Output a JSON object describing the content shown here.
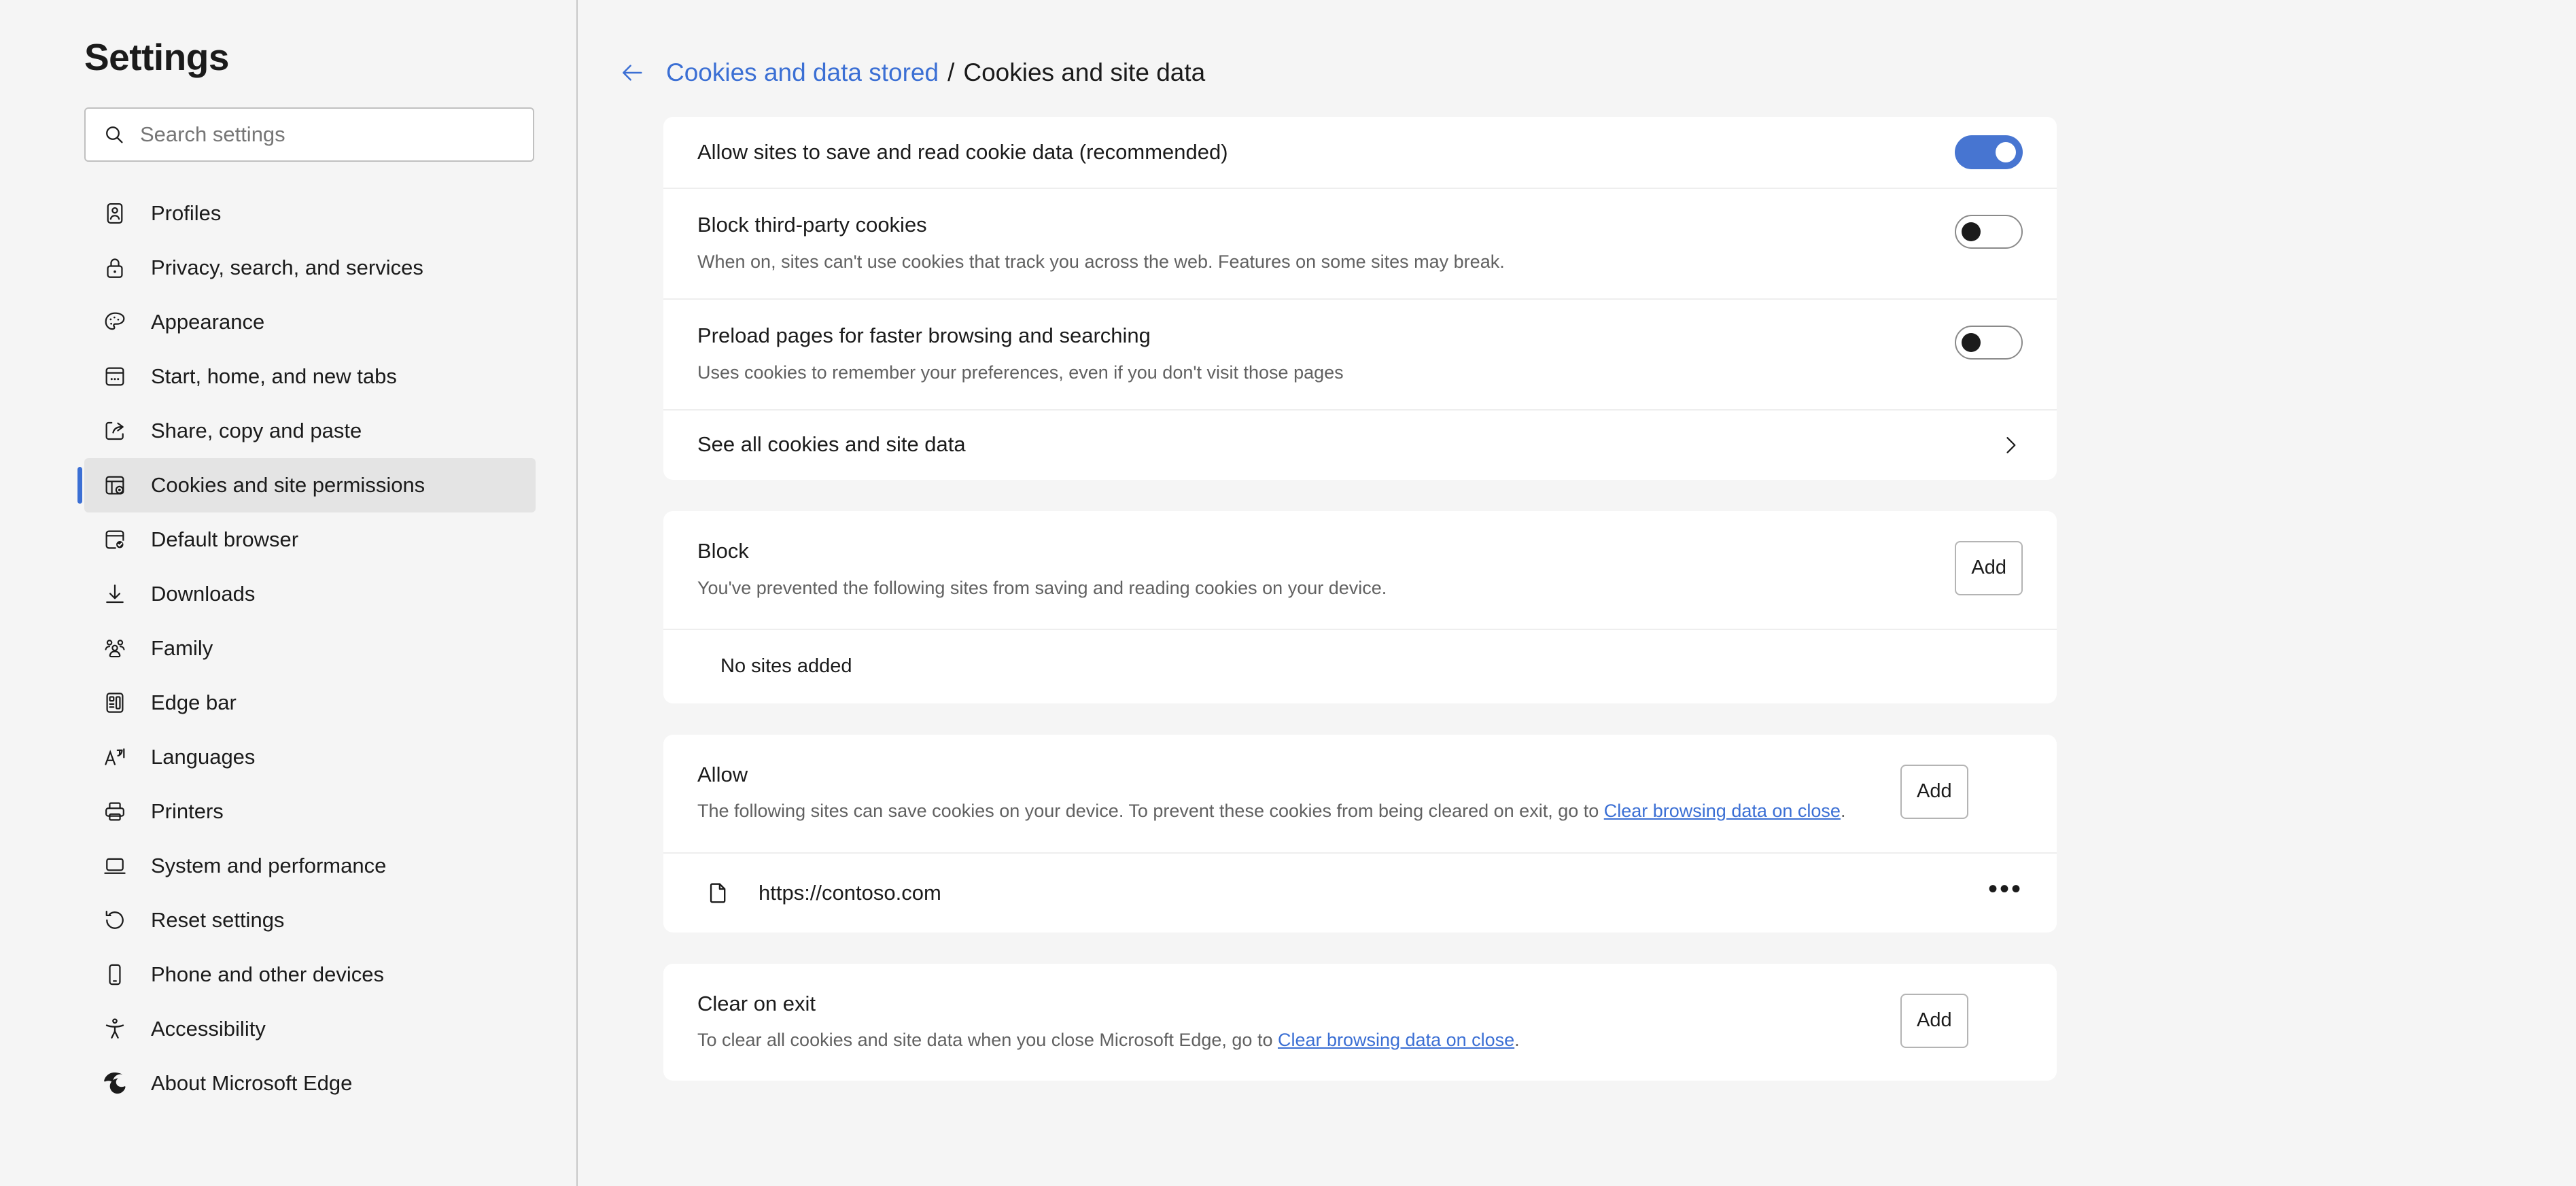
{
  "sidebar": {
    "title": "Settings",
    "search": {
      "placeholder": "Search settings",
      "value": "",
      "icon": "search-icon"
    },
    "items": [
      {
        "label": "Profiles",
        "icon": "profiles-icon",
        "selected": false
      },
      {
        "label": "Privacy, search, and services",
        "icon": "lock-icon",
        "selected": false
      },
      {
        "label": "Appearance",
        "icon": "palette-icon",
        "selected": false
      },
      {
        "label": "Start, home, and new tabs",
        "icon": "window-new-tab-icon",
        "selected": false
      },
      {
        "label": "Share, copy and paste",
        "icon": "share-icon",
        "selected": false
      },
      {
        "label": "Cookies and site permissions",
        "icon": "cookies-permissions-icon",
        "selected": true
      },
      {
        "label": "Default browser",
        "icon": "default-browser-icon",
        "selected": false
      },
      {
        "label": "Downloads",
        "icon": "download-icon",
        "selected": false
      },
      {
        "label": "Family",
        "icon": "family-icon",
        "selected": false
      },
      {
        "label": "Edge bar",
        "icon": "edge-bar-icon",
        "selected": false
      },
      {
        "label": "Languages",
        "icon": "languages-icon",
        "selected": false
      },
      {
        "label": "Printers",
        "icon": "printer-icon",
        "selected": false
      },
      {
        "label": "System and performance",
        "icon": "laptop-icon",
        "selected": false
      },
      {
        "label": "Reset settings",
        "icon": "reset-icon",
        "selected": false
      },
      {
        "label": "Phone and other devices",
        "icon": "phone-icon",
        "selected": false
      },
      {
        "label": "Accessibility",
        "icon": "accessibility-icon",
        "selected": false
      },
      {
        "label": "About Microsoft Edge",
        "icon": "edge-logo-icon",
        "selected": false
      }
    ]
  },
  "breadcrumb": {
    "back_icon": "back-arrow-icon",
    "parent": "Cookies and data stored",
    "separator": "/",
    "current": "Cookies and site data"
  },
  "cookie_settings": {
    "allow_save_read": {
      "title": "Allow sites to save and read cookie data (recommended)",
      "toggle_state": "on"
    },
    "block_third_party": {
      "title": "Block third-party cookies",
      "description": "When on, sites can't use cookies that track you across the web. Features on some sites may break.",
      "toggle_state": "off"
    },
    "preload_pages": {
      "title": "Preload pages for faster browsing and searching",
      "description": "Uses cookies to remember your preferences, even if you don't visit those pages",
      "toggle_state": "off"
    },
    "see_all": {
      "title": "See all cookies and site data",
      "icon": "chevron-right-icon"
    }
  },
  "block_section": {
    "title": "Block",
    "description": "You've prevented the following sites from saving and reading cookies on your device.",
    "add_label": "Add",
    "empty_text": "No sites added"
  },
  "allow_section": {
    "title": "Allow",
    "description_before": "The following sites can save cookies on your device. To prevent these cookies from being cleared on exit, go to ",
    "link_text": "Clear browsing data on close",
    "description_after": ".",
    "add_label": "Add",
    "sites": [
      {
        "name": "https://contoso.com",
        "icon": "document-icon",
        "more_icon": "more-options-icon",
        "more_label": "•••"
      }
    ]
  },
  "clear_on_exit_section": {
    "title": "Clear on exit",
    "description_before": "To clear all cookies and site data when you close Microsoft Edge, go to ",
    "link_text": "Clear browsing data on close",
    "description_after": ".",
    "add_label": "Add"
  },
  "colors": {
    "accent": "#3b6fd4",
    "toggle_on": "#4775d1",
    "page_bg": "#f5f5f5",
    "card_bg": "#ffffff",
    "selected_bg": "#e4e4e4",
    "text_primary": "#1b1b1b",
    "text_secondary": "#616161"
  }
}
